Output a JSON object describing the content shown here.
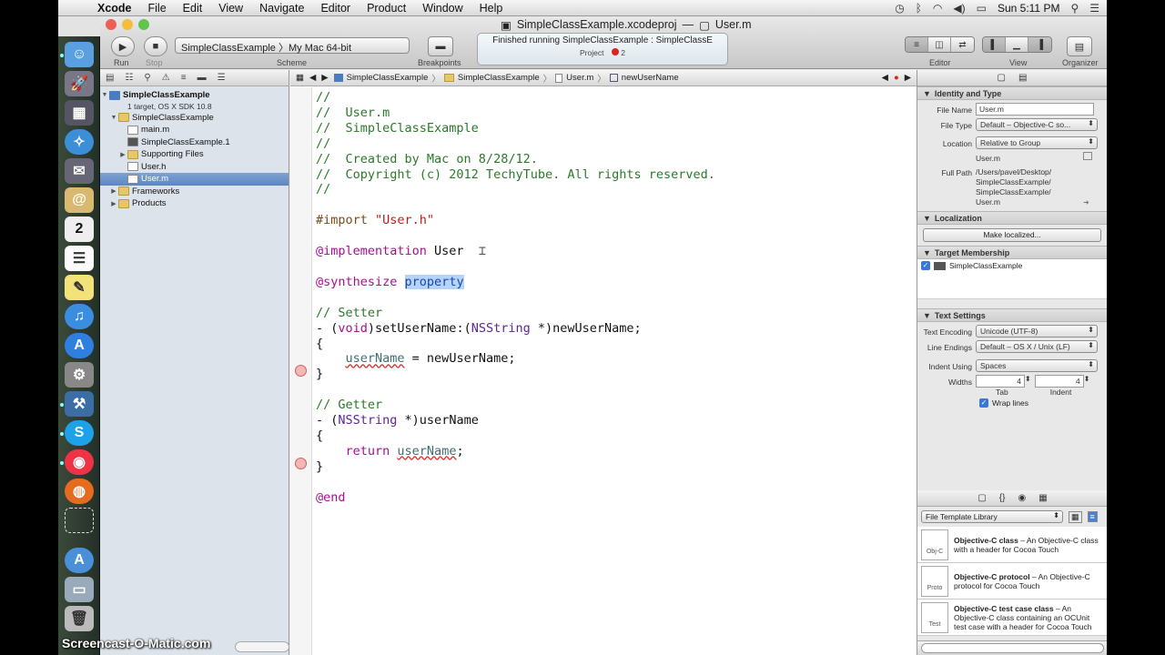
{
  "menubar": {
    "app": "Xcode",
    "items": [
      "File",
      "Edit",
      "View",
      "Navigate",
      "Editor",
      "Product",
      "Window",
      "Help"
    ],
    "clock": "Sun 5:11 PM"
  },
  "window": {
    "title_project": "SimpleClassExample.xcodeproj",
    "title_sep": "—",
    "title_file": "User.m"
  },
  "toolbar": {
    "run_label": "Run",
    "stop_label": "Stop",
    "scheme_label": "Scheme",
    "scheme_value": "SimpleClassExample 〉My Mac 64-bit",
    "breakpoints_label": "Breakpoints",
    "activity_text": "Finished running SimpleClassExample : SimpleClassE",
    "activity_sub": "Project",
    "activity_errors": "2",
    "editor_label": "Editor",
    "view_label": "View",
    "organizer_label": "Organizer"
  },
  "navigator": {
    "project_name": "SimpleClassExample",
    "project_sub": "1 target, OS X SDK 10.8",
    "items": [
      {
        "label": "SimpleClassExample",
        "kind": "folder",
        "indent": 1,
        "disc": "▼"
      },
      {
        "label": "main.m",
        "kind": "m",
        "indent": 2,
        "disc": ""
      },
      {
        "label": "SimpleClassExample.1",
        "kind": "doc",
        "indent": 2,
        "disc": ""
      },
      {
        "label": "Supporting Files",
        "kind": "folder",
        "indent": 2,
        "disc": "▶"
      },
      {
        "label": "User.h",
        "kind": "h",
        "indent": 2,
        "disc": ""
      },
      {
        "label": "User.m",
        "kind": "m",
        "indent": 2,
        "disc": "",
        "selected": true
      },
      {
        "label": "Frameworks",
        "kind": "folder",
        "indent": 1,
        "disc": "▶"
      },
      {
        "label": "Products",
        "kind": "folder",
        "indent": 1,
        "disc": "▶"
      }
    ]
  },
  "jumpbar": {
    "crumbs": [
      "SimpleClassExample",
      "SimpleClassExample",
      "User.m",
      "newUserName"
    ]
  },
  "code": {
    "l1": "//",
    "l2": "//  User.m",
    "l3": "//  SimpleClassExample",
    "l4": "//",
    "l5": "//  Created by Mac on 8/28/12.",
    "l6": "//  Copyright (c) 2012 TechyTube. All rights reserved.",
    "l7": "//",
    "import_kw": "#import ",
    "import_str": "\"User.h\"",
    "impl_kw": "@implementation",
    "impl_name": " User",
    "synth_kw": "@synthesize ",
    "synth_sel": "property",
    "setter_comment": "// Setter",
    "setter_sig_a": "- (",
    "setter_void": "void",
    "setter_sig_b": ")setUserName:(",
    "setter_type": "NSString",
    "setter_sig_c": " *)newUserName;",
    "brace_open": "{",
    "indent": "    ",
    "setter_var": "userName",
    "setter_rest": " = newUserName;",
    "brace_close": "}",
    "getter_comment": "// Getter",
    "getter_sig_a": "- (",
    "getter_type": "NSString",
    "getter_sig_b": " *)userName",
    "return_kw": "return ",
    "getter_var": "userName",
    "semicolon": ";",
    "end_kw": "@end"
  },
  "utilities": {
    "identity_header": "Identity and Type",
    "file_name_label": "File Name",
    "file_name_value": "User.m",
    "file_type_label": "File Type",
    "file_type_value": "Default – Objective-C so...",
    "location_label": "Location",
    "location_value": "Relative to Group",
    "location_file": "User.m",
    "full_path_label": "Full Path",
    "full_path_value": [
      "/Users/pavel/Desktop/",
      "SimpleClassExample/",
      "SimpleClassExample/",
      "User.m"
    ],
    "localization_header": "Localization",
    "make_localized": "Make localized...",
    "target_header": "Target Membership",
    "target_name": "SimpleClassExample",
    "text_settings_header": "Text Settings",
    "encoding_label": "Text Encoding",
    "encoding_value": "Unicode (UTF-8)",
    "line_endings_label": "Line Endings",
    "line_endings_value": "Default – OS X / Unix (LF)",
    "indent_using_label": "Indent Using",
    "indent_using_value": "Spaces",
    "widths_label": "Widths",
    "tab_value": "4",
    "indent_value": "4",
    "tab_caption": "Tab",
    "indent_caption": "Indent",
    "wrap_lines": "Wrap lines",
    "library_select": "File Template Library",
    "library": [
      {
        "title": "Objective-C class",
        "desc": " – An Objective-C class with a header for Cocoa Touch",
        "icon": "Obj-C"
      },
      {
        "title": "Objective-C protocol",
        "desc": " – An Objective-C protocol for Cocoa Touch",
        "icon": "Proto"
      },
      {
        "title": "Objective-C test case class",
        "desc": " – An Objective-C class containing an OCUnit test case with a header for Cocoa Touch",
        "icon": "Test"
      }
    ]
  },
  "watermark": "Screencast-O-Matic.com"
}
